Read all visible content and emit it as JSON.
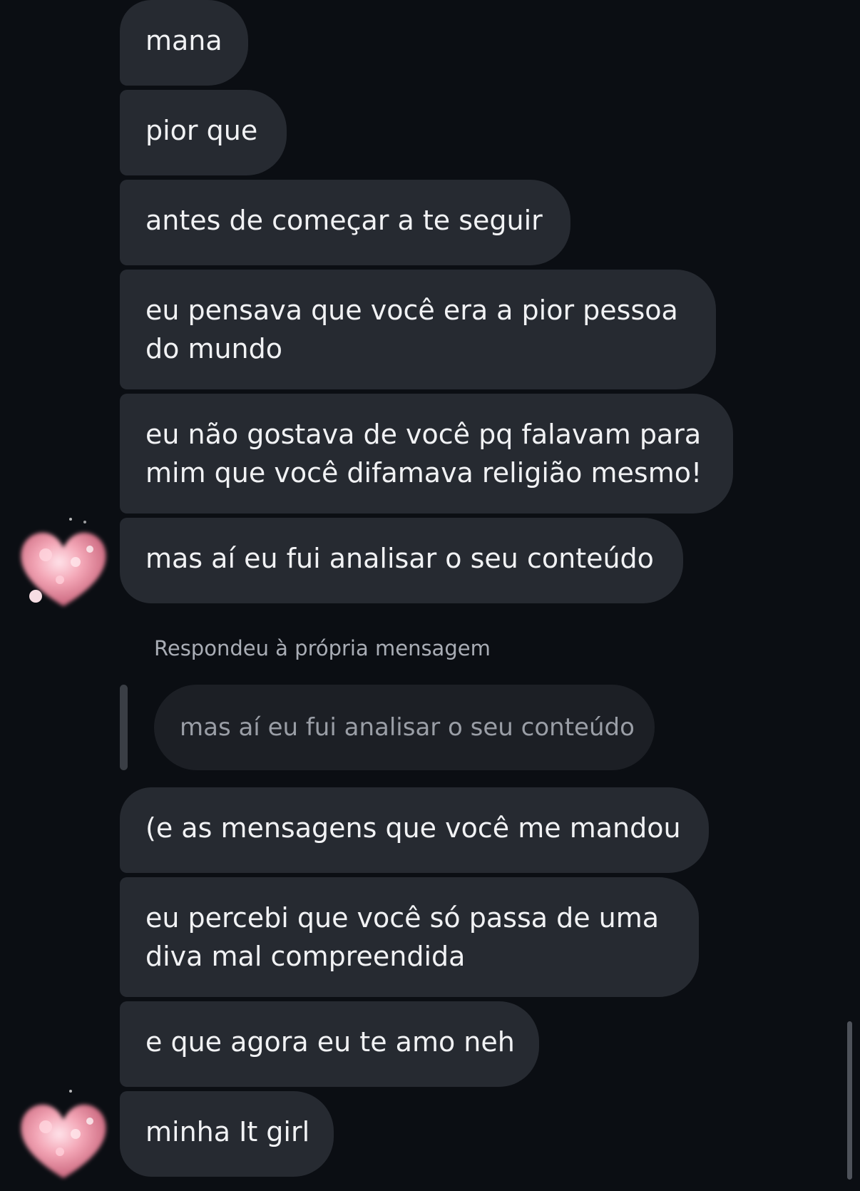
{
  "messages": [
    {
      "text": "mana"
    },
    {
      "text": "pior que"
    },
    {
      "text": "antes de começar a te seguir"
    },
    {
      "text": "eu pensava que você era a pior pessoa do mundo"
    },
    {
      "text": "eu não gostava de você pq falavam para mim que você difamava religião mesmo!"
    },
    {
      "text": "mas aí eu fui analisar o seu conteúdo"
    },
    {
      "text": "(e as mensagens que você me mandou"
    },
    {
      "text": "eu percebi que você só passa de uma diva mal compreendida"
    },
    {
      "text": "e que agora eu te amo neh"
    },
    {
      "text": "minha It girl"
    }
  ],
  "reply": {
    "label": "Respondeu à própria mensagem",
    "quoted_text": "mas aí eu fui analisar o seu conteúdo"
  },
  "avatar_icon": "pink-heart-sticker-avatar-icon",
  "colors": {
    "background": "#0b0e13",
    "bubble": "#262a31",
    "text": "#f1f2f4",
    "accent_pink": "#f0a4b4"
  }
}
